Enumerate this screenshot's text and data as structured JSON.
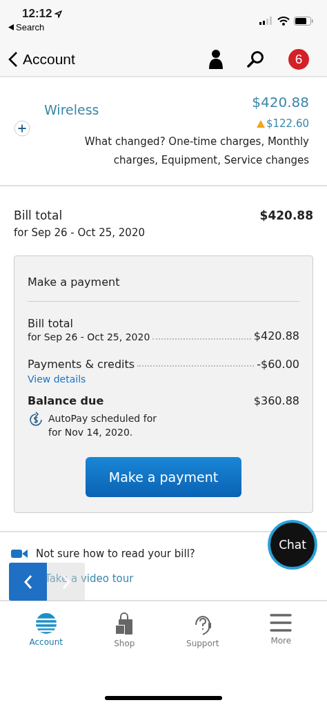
{
  "status_bar": {
    "time": "12:12",
    "back_label": "Search"
  },
  "header": {
    "title": "Account",
    "badge": "6"
  },
  "wireless": {
    "name": "Wireless",
    "amount": "$420.88",
    "change": "$122.60",
    "note": "What changed? One-time charges, Monthly charges, Equipment, Service changes"
  },
  "bill_total": {
    "label": "Bill total",
    "period": "for Sep 26 - Oct 25, 2020",
    "amount": "$420.88"
  },
  "payment_card": {
    "title": "Make a payment",
    "lines": [
      {
        "label": "Bill total",
        "sub": "for Sep 26 - Oct 25, 2020",
        "amount": "$420.88"
      },
      {
        "label": "Payments & credits",
        "link": "View details",
        "amount": "-$60.00"
      }
    ],
    "balance": {
      "label": "Balance due",
      "amount": "$360.88",
      "autopay": "AutoPay scheduled for for Nov 14, 2020."
    },
    "button": "Make a payment"
  },
  "help": {
    "question": "Not sure how to read your bill?",
    "link": "Take a video tour"
  },
  "chat": {
    "label": "Chat"
  },
  "tab_bar": [
    {
      "label": "Account",
      "selected": true
    },
    {
      "label": "Shop",
      "selected": false
    },
    {
      "label": "Support",
      "selected": false
    },
    {
      "label": "More",
      "selected": false
    }
  ]
}
